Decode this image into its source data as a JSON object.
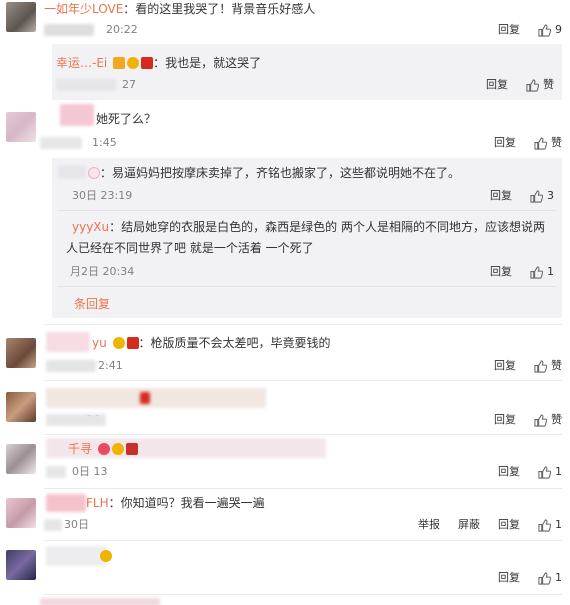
{
  "actions": {
    "reply": "回复",
    "like": "赞",
    "report": "举报",
    "block": "屏蔽",
    "more_replies": "条回复"
  },
  "comments": [
    {
      "user": "一如年少LOVE",
      "text": "：看的这里我哭了！背景音乐好感人",
      "time": "20:22",
      "like_count": "9"
    },
    {
      "user": "幸运…-Ei",
      "text": "：我也是，就这哭了",
      "time": "27",
      "like_count": ""
    },
    {
      "user": "",
      "text": "她死了么？",
      "time": "1:45",
      "like_count": ""
    },
    {
      "user": "",
      "text": "：易逼妈妈把按摩床卖掉了，齐铭也搬家了，这些都说明她不在了。",
      "time": "30日 23:19",
      "like_count": "3"
    },
    {
      "user": "yyyXu",
      "text": "：结局她穿的衣服是白色的，森西是绿色的 两个人是相隔的不同地方，应该想说两",
      "text2": "人已经在不同世界了吧 就是一个活着 一个死了",
      "time": "月2日 20:34",
      "like_count": "1"
    },
    {
      "user": "yu",
      "text": "：枪版质量不会太差吧，毕竟要钱的",
      "time": "2:41",
      "like_count": ""
    },
    {
      "user": "",
      "text": "",
      "time": "36",
      "like_count": ""
    },
    {
      "user": "千寻",
      "text": "",
      "time": "0日 13",
      "like_count": "1"
    },
    {
      "user": "FLH",
      "text": "：你知道吗？我看一遍哭一遍",
      "time": "30日",
      "like_count": "1"
    },
    {
      "user": "",
      "text": "",
      "time": "",
      "like_count": "1"
    }
  ]
}
